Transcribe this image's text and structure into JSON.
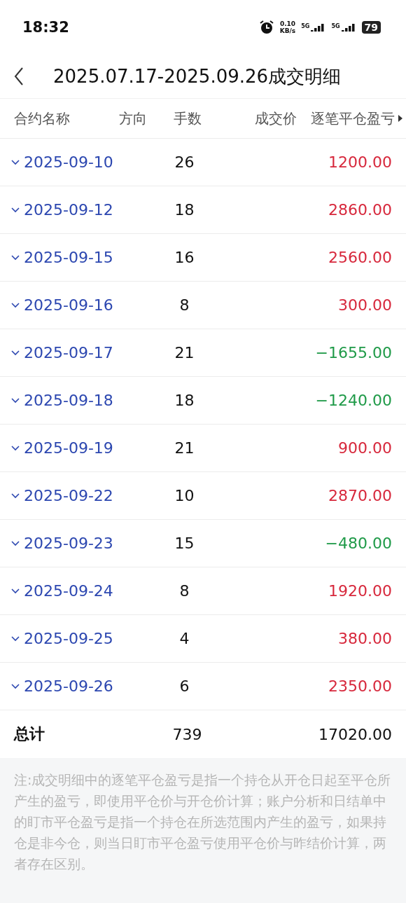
{
  "status_bar": {
    "time": "18:32",
    "net_speed": "0.10",
    "net_unit": "KB/s",
    "sim1": "5G",
    "sim2": "5G",
    "battery": "79"
  },
  "header": {
    "title": "2025.07.17-2025.09.26成交明细"
  },
  "table": {
    "columns": [
      "合约名称",
      "方向",
      "手数",
      "成交价",
      "逐笔平仓盈亏"
    ],
    "rows": [
      {
        "date": "2025-09-10",
        "lots": "26",
        "pnl": "1200.00",
        "color": "#d7283c",
        "expanded": false
      },
      {
        "date": "2025-09-12",
        "lots": "18",
        "pnl": "2860.00",
        "color": "#d7283c",
        "expanded": false
      },
      {
        "date": "2025-09-15",
        "lots": "16",
        "pnl": "2560.00",
        "color": "#d7283c",
        "expanded": false
      },
      {
        "date": "2025-09-16",
        "lots": "8",
        "pnl": "300.00",
        "color": "#d7283c",
        "expanded": false
      },
      {
        "date": "2025-09-17",
        "lots": "21",
        "pnl": "−1655.00",
        "color": "#1f9a48",
        "expanded": false
      },
      {
        "date": "2025-09-18",
        "lots": "18",
        "pnl": "−1240.00",
        "color": "#1f9a48",
        "expanded": false
      },
      {
        "date": "2025-09-19",
        "lots": "21",
        "pnl": "900.00",
        "color": "#d7283c",
        "expanded": false
      },
      {
        "date": "2025-09-22",
        "lots": "10",
        "pnl": "2870.00",
        "color": "#d7283c",
        "expanded": false
      },
      {
        "date": "2025-09-23",
        "lots": "15",
        "pnl": "−480.00",
        "color": "#1f9a48",
        "expanded": false
      },
      {
        "date": "2025-09-24",
        "lots": "8",
        "pnl": "1920.00",
        "color": "#d7283c",
        "expanded": false
      },
      {
        "date": "2025-09-25",
        "lots": "4",
        "pnl": "380.00",
        "color": "#d7283c",
        "expanded": false
      },
      {
        "date": "2025-09-26",
        "lots": "6",
        "pnl": "2350.00",
        "color": "#d7283c",
        "expanded": false
      }
    ],
    "total": {
      "label": "总计",
      "lots": "739",
      "pnl": "17020.00"
    }
  },
  "note": "注:成交明细中的逐笔平仓盈亏是指一个持仓从开仓日起至平仓所产生的盈亏，即使用平仓价与开仓价计算；账户分析和日结单中的盯市平仓盈亏是指一个持仓在所选范围内产生的盈亏，如果持仓是非今仓，则当日盯市平仓盈亏使用平仓价与昨结价计算，两者存在区别。"
}
